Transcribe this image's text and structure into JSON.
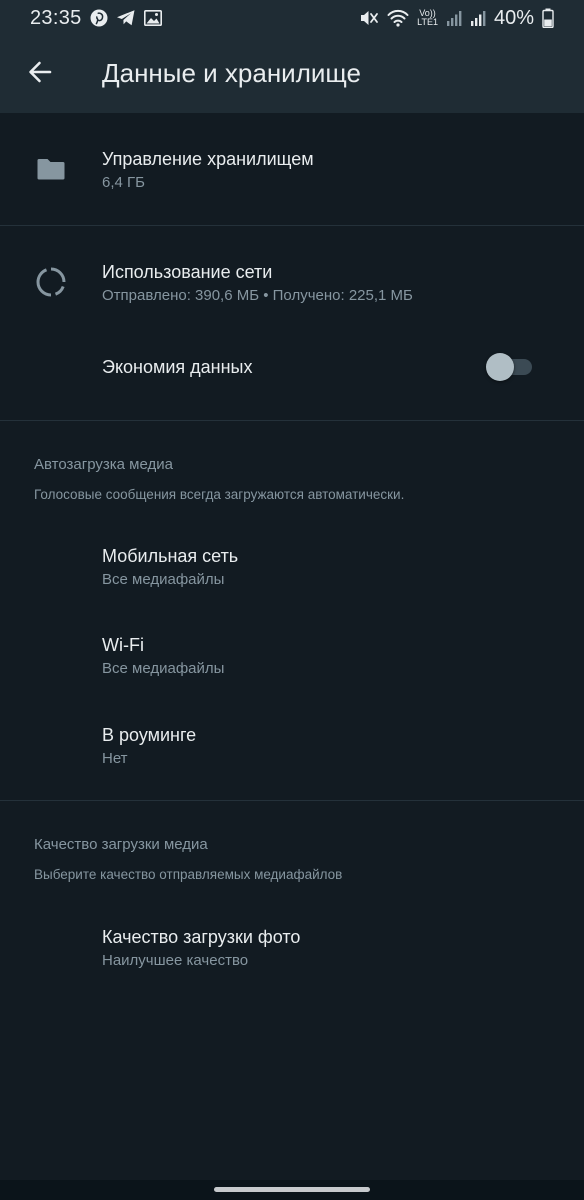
{
  "status_bar": {
    "time": "23:35",
    "battery": "40%",
    "network_label_top": "Vo))",
    "network_label_bottom": "LTE1",
    "icons": [
      "pinterest-icon",
      "telegram-icon",
      "gallery-icon",
      "mute-icon",
      "wifi-icon",
      "signal-icon",
      "battery-icon"
    ]
  },
  "app_bar": {
    "title": "Данные и хранилище",
    "back_icon": "arrow-left-icon"
  },
  "storage": {
    "title": "Управление хранилищем",
    "subtitle": "6,4 ГБ",
    "icon": "folder-icon"
  },
  "network": {
    "title": "Использование сети",
    "subtitle": "Отправлено: 390,6 МБ • Получено: 225,1 МБ",
    "icon": "data-usage-icon"
  },
  "data_saver": {
    "title": "Экономия данных",
    "enabled": false
  },
  "auto_download": {
    "header": "Автозагрузка медиа",
    "description": "Голосовые сообщения всегда загружаются автоматически.",
    "items": [
      {
        "title": "Мобильная сеть",
        "subtitle": "Все медиафайлы"
      },
      {
        "title": "Wi-Fi",
        "subtitle": "Все медиафайлы"
      },
      {
        "title": "В роуминге",
        "subtitle": "Нет"
      }
    ]
  },
  "upload_quality": {
    "header": "Качество загрузки медиа",
    "description": "Выберите качество отправляемых медиафайлов",
    "items": [
      {
        "title": "Качество загрузки фото",
        "subtitle": "Наилучшее качество"
      }
    ]
  },
  "colors": {
    "background": "#121b22",
    "app_bar": "#1f2c34",
    "primary_text": "#e9edef",
    "secondary_text": "#8696a0",
    "divider": "#24313a"
  }
}
